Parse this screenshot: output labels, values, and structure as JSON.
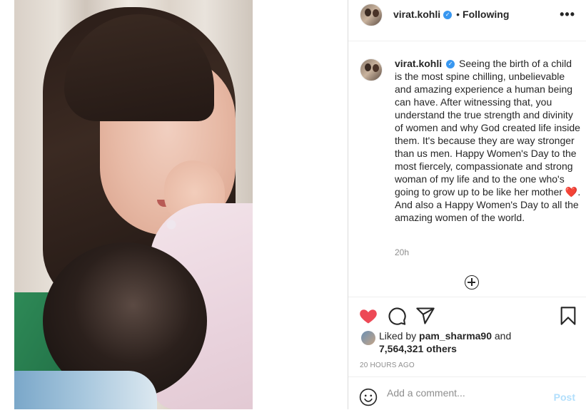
{
  "post": {
    "author": "virat.kohli",
    "follow_separator": "•",
    "follow_status": "Following",
    "more_label": "•••",
    "caption_text": " Seeing the birth of a child is the most spine chilling, unbelievable and amazing experience a human being can have. After witnessing that, you understand the true strength and divinity of women and why God created life inside them. It's because they are way stronger than us men. Happy Women's Day to the most fiercely, compassionate and strong woman of my life and to the one who's going to grow up to be like her mother ",
    "caption_emoji": "❤️",
    "caption_end": ". And also a Happy Women's Day to all the amazing women of the world.",
    "caption_age": "20h"
  },
  "likes": {
    "prefix": "Liked by ",
    "user": "pam_sharma90",
    "joiner": " and",
    "count": "7,564,321 others"
  },
  "timestamp": "20 HOURS AGO",
  "comment": {
    "placeholder": "Add a comment...",
    "post_label": "Post"
  },
  "colors": {
    "like_heart": "#ed4956",
    "verified": "#3897f0",
    "post_disabled": "#b2dffc"
  },
  "icons": [
    "verified-badge-icon",
    "more-options-icon",
    "load-more-comments-icon",
    "heart-icon",
    "comment-icon",
    "share-icon",
    "bookmark-icon",
    "emoji-icon"
  ]
}
